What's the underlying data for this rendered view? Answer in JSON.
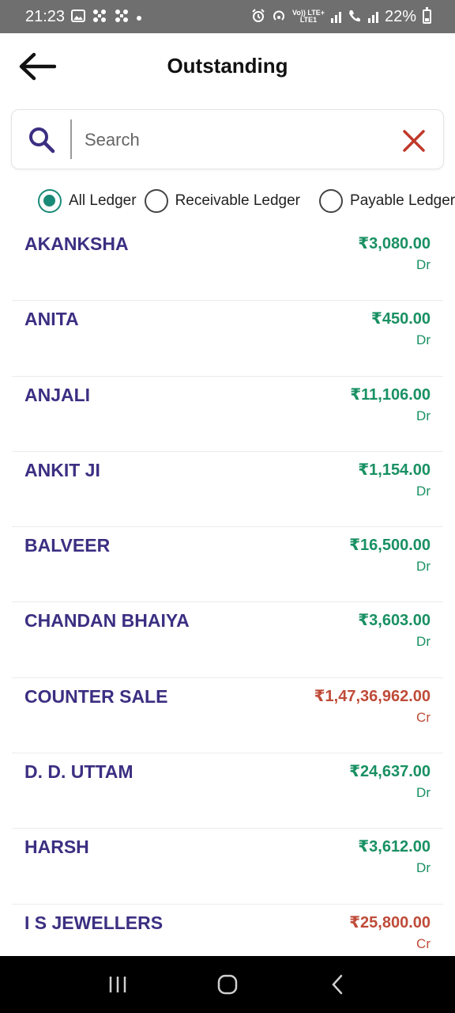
{
  "status_bar": {
    "time": "21:23",
    "network_line1": "Vo)) LTE+",
    "network_line2": "LTE1",
    "battery": "22%"
  },
  "header": {
    "title": "Outstanding"
  },
  "search": {
    "placeholder": "Search",
    "value": ""
  },
  "filters": {
    "options": [
      {
        "label": "All Ledger",
        "checked": true
      },
      {
        "label": "Receivable Ledger",
        "checked": false
      },
      {
        "label": "Payable Ledger",
        "checked": false
      }
    ]
  },
  "ledgers": [
    {
      "name": "AKANKSHA",
      "amount": "₹3,080.00",
      "type": "Dr"
    },
    {
      "name": "ANITA",
      "amount": "₹450.00",
      "type": "Dr"
    },
    {
      "name": "ANJALI",
      "amount": "₹11,106.00",
      "type": "Dr"
    },
    {
      "name": "ANKIT JI",
      "amount": "₹1,154.00",
      "type": "Dr"
    },
    {
      "name": "BALVEER",
      "amount": "₹16,500.00",
      "type": "Dr"
    },
    {
      "name": "CHANDAN BHAIYA",
      "amount": "₹3,603.00",
      "type": "Dr"
    },
    {
      "name": "COUNTER SALE",
      "amount": "₹1,47,36,962.00",
      "type": "Cr"
    },
    {
      "name": "D. D. UTTAM",
      "amount": "₹24,637.00",
      "type": "Dr"
    },
    {
      "name": "HARSH",
      "amount": "₹3,612.00",
      "type": "Dr"
    },
    {
      "name": "I S JEWELLERS",
      "amount": "₹25,800.00",
      "type": "Cr"
    }
  ],
  "colors": {
    "title_text": "#3b2f82",
    "debit": "#199063",
    "credit": "#bf4b38",
    "radio_selected": "#1a8a78",
    "clear_icon": "#c0392b"
  },
  "icons": {
    "back": "arrow-left-icon",
    "search": "search-icon",
    "clear": "close-icon",
    "nav_recents": "recents-icon",
    "nav_home": "home-icon",
    "nav_back": "back-chevron-icon"
  }
}
